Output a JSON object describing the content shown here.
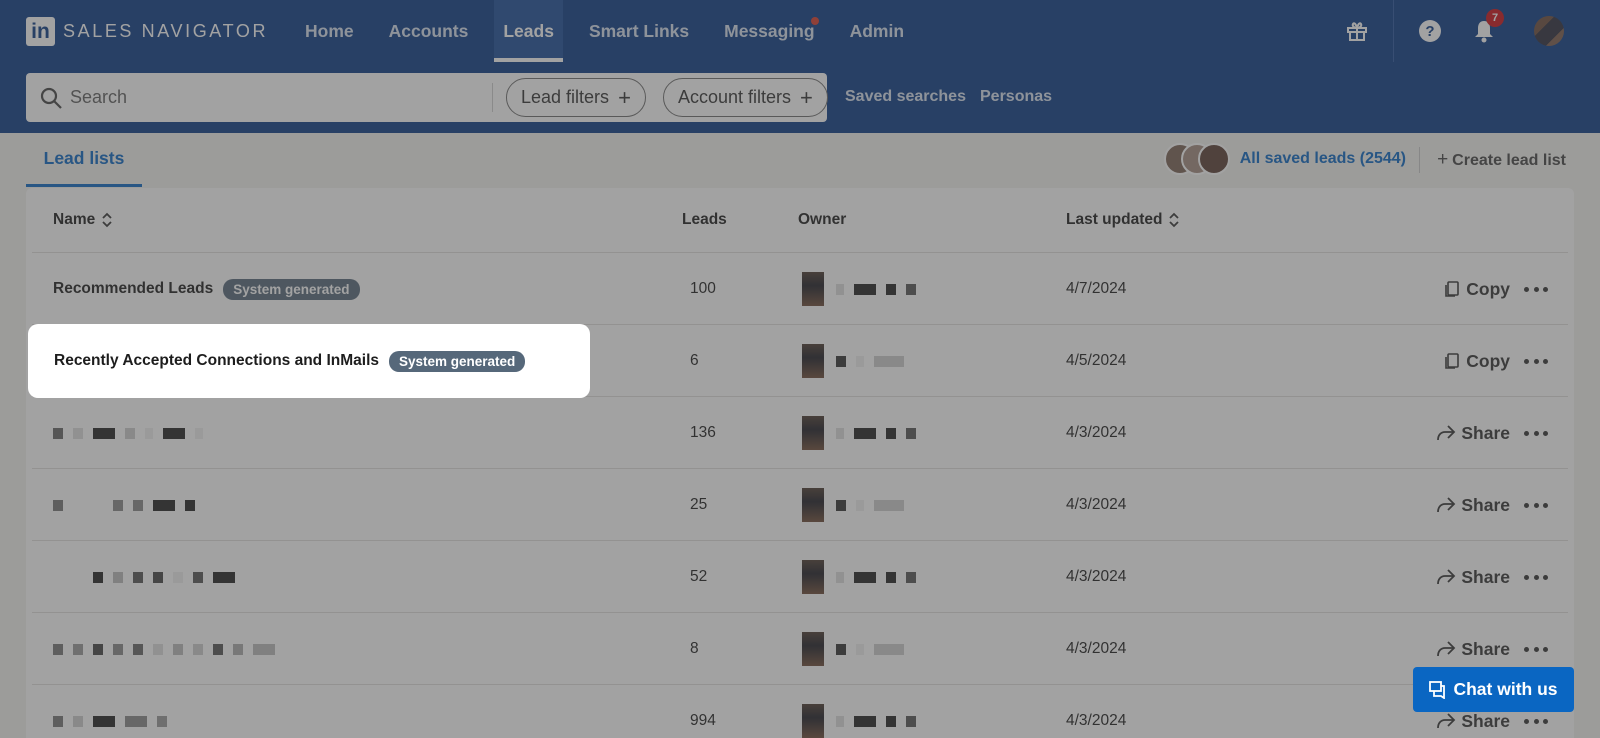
{
  "brand": {
    "logo_mark": "in",
    "product_name": "SALES NAVIGATOR"
  },
  "nav": {
    "items": [
      {
        "label": "Home"
      },
      {
        "label": "Accounts"
      },
      {
        "label": "Leads",
        "active": true
      },
      {
        "label": "Smart Links"
      },
      {
        "label": "Messaging",
        "has_dot": true
      },
      {
        "label": "Admin"
      }
    ],
    "notifications_count": "7",
    "icons": [
      "gift-icon",
      "help-icon",
      "bell-icon"
    ]
  },
  "search": {
    "placeholder": "Search",
    "lead_filters_label": "Lead filters",
    "account_filters_label": "Account filters",
    "saved_searches_label": "Saved searches",
    "personas_label": "Personas"
  },
  "tabs": {
    "lead_lists_label": "Lead lists"
  },
  "toolbar": {
    "all_saved_leads_label": "All saved leads (2544)",
    "create_lead_list_label": "Create lead list"
  },
  "table": {
    "headers": {
      "name": "Name",
      "leads": "Leads",
      "owner": "Owner",
      "last_updated": "Last updated"
    },
    "badge_label": "System generated",
    "rows": [
      {
        "name": "Recommended Leads",
        "badge": true,
        "leads": "100",
        "date": "4/7/2024",
        "action": "Copy"
      },
      {
        "name": "Recently Accepted Connections and InMails",
        "badge": true,
        "leads": "6",
        "date": "4/5/2024",
        "action": "Copy"
      },
      {
        "name": "",
        "badge": false,
        "leads": "136",
        "date": "4/3/2024",
        "action": "Share"
      },
      {
        "name": "",
        "badge": false,
        "leads": "25",
        "date": "4/3/2024",
        "action": "Share"
      },
      {
        "name": "",
        "badge": false,
        "leads": "52",
        "date": "4/3/2024",
        "action": "Share"
      },
      {
        "name": "",
        "badge": false,
        "leads": "8",
        "date": "4/3/2024",
        "action": "Share"
      },
      {
        "name": "",
        "badge": false,
        "leads": "994",
        "date": "4/3/2024",
        "action": "Share"
      }
    ]
  },
  "chat": {
    "label": "Chat with us"
  },
  "colors": {
    "nav_bg": "#0a3a85",
    "accent": "#0a66c2",
    "badge_bg": "#56687a",
    "notification": "#cc1016"
  }
}
